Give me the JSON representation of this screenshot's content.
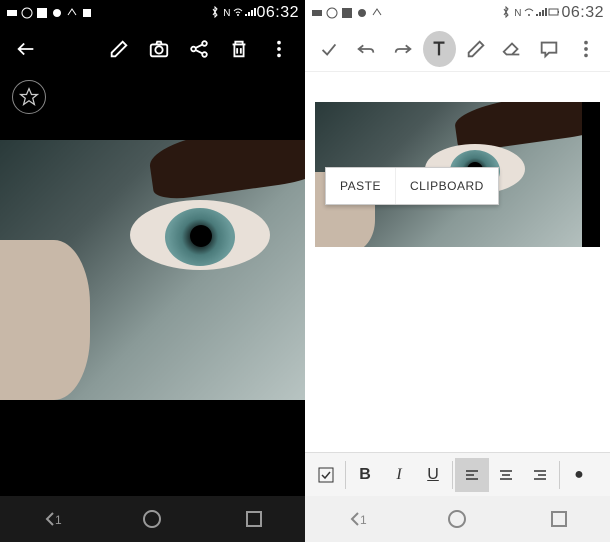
{
  "status": {
    "time": "06:32"
  },
  "left_toolbar": {
    "back": "back",
    "edit": "edit",
    "camera": "camera",
    "share": "share",
    "delete": "delete",
    "more": "more"
  },
  "right_toolbar": {
    "check": "done",
    "undo": "undo",
    "redo": "redo",
    "text": "text",
    "pen": "pen",
    "eraser": "eraser",
    "speech": "comment",
    "more": "more"
  },
  "context_menu": {
    "paste": "PASTE",
    "clipboard": "CLIPBOARD"
  },
  "format_bar": {
    "checkbox": "☑",
    "bold": "B",
    "italic": "I",
    "underline": "U",
    "align_left": "≡",
    "align_center": "≡",
    "align_right": "≡",
    "bullet": "●"
  },
  "nav": {
    "back": "<1",
    "home": "○",
    "recent": "□"
  }
}
